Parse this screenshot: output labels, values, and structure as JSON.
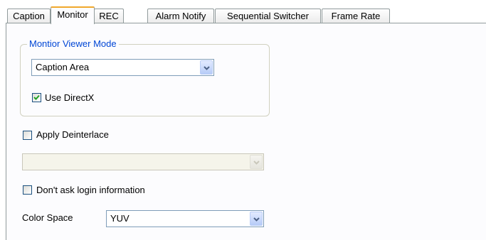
{
  "tabs": [
    {
      "label": "Caption",
      "active": false
    },
    {
      "label": "Monitor",
      "active": true
    },
    {
      "label": "REC",
      "active": false
    },
    {
      "label": "Alarm Notify",
      "active": false
    },
    {
      "label": "Sequential Switcher",
      "active": false
    },
    {
      "label": "Frame Rate",
      "active": false
    }
  ],
  "monitor_viewer": {
    "group_title": "Montior Viewer Mode",
    "mode_value": "Caption Area",
    "use_directx_label": "Use DirectX",
    "use_directx_checked": true
  },
  "apply_deinterlace": {
    "label": "Apply Deinterlace",
    "checked": false,
    "select_value": ""
  },
  "dont_ask_login": {
    "label": "Don't ask login information",
    "checked": false
  },
  "color_space": {
    "label": "Color Space",
    "value": "YUV"
  },
  "colors": {
    "accent_tab": "#f0a82c",
    "group_title": "#0046d5",
    "check": "#21a121"
  },
  "icons": {
    "dropdown": "chevron-down-icon",
    "checkmark": "checkmark-icon"
  }
}
